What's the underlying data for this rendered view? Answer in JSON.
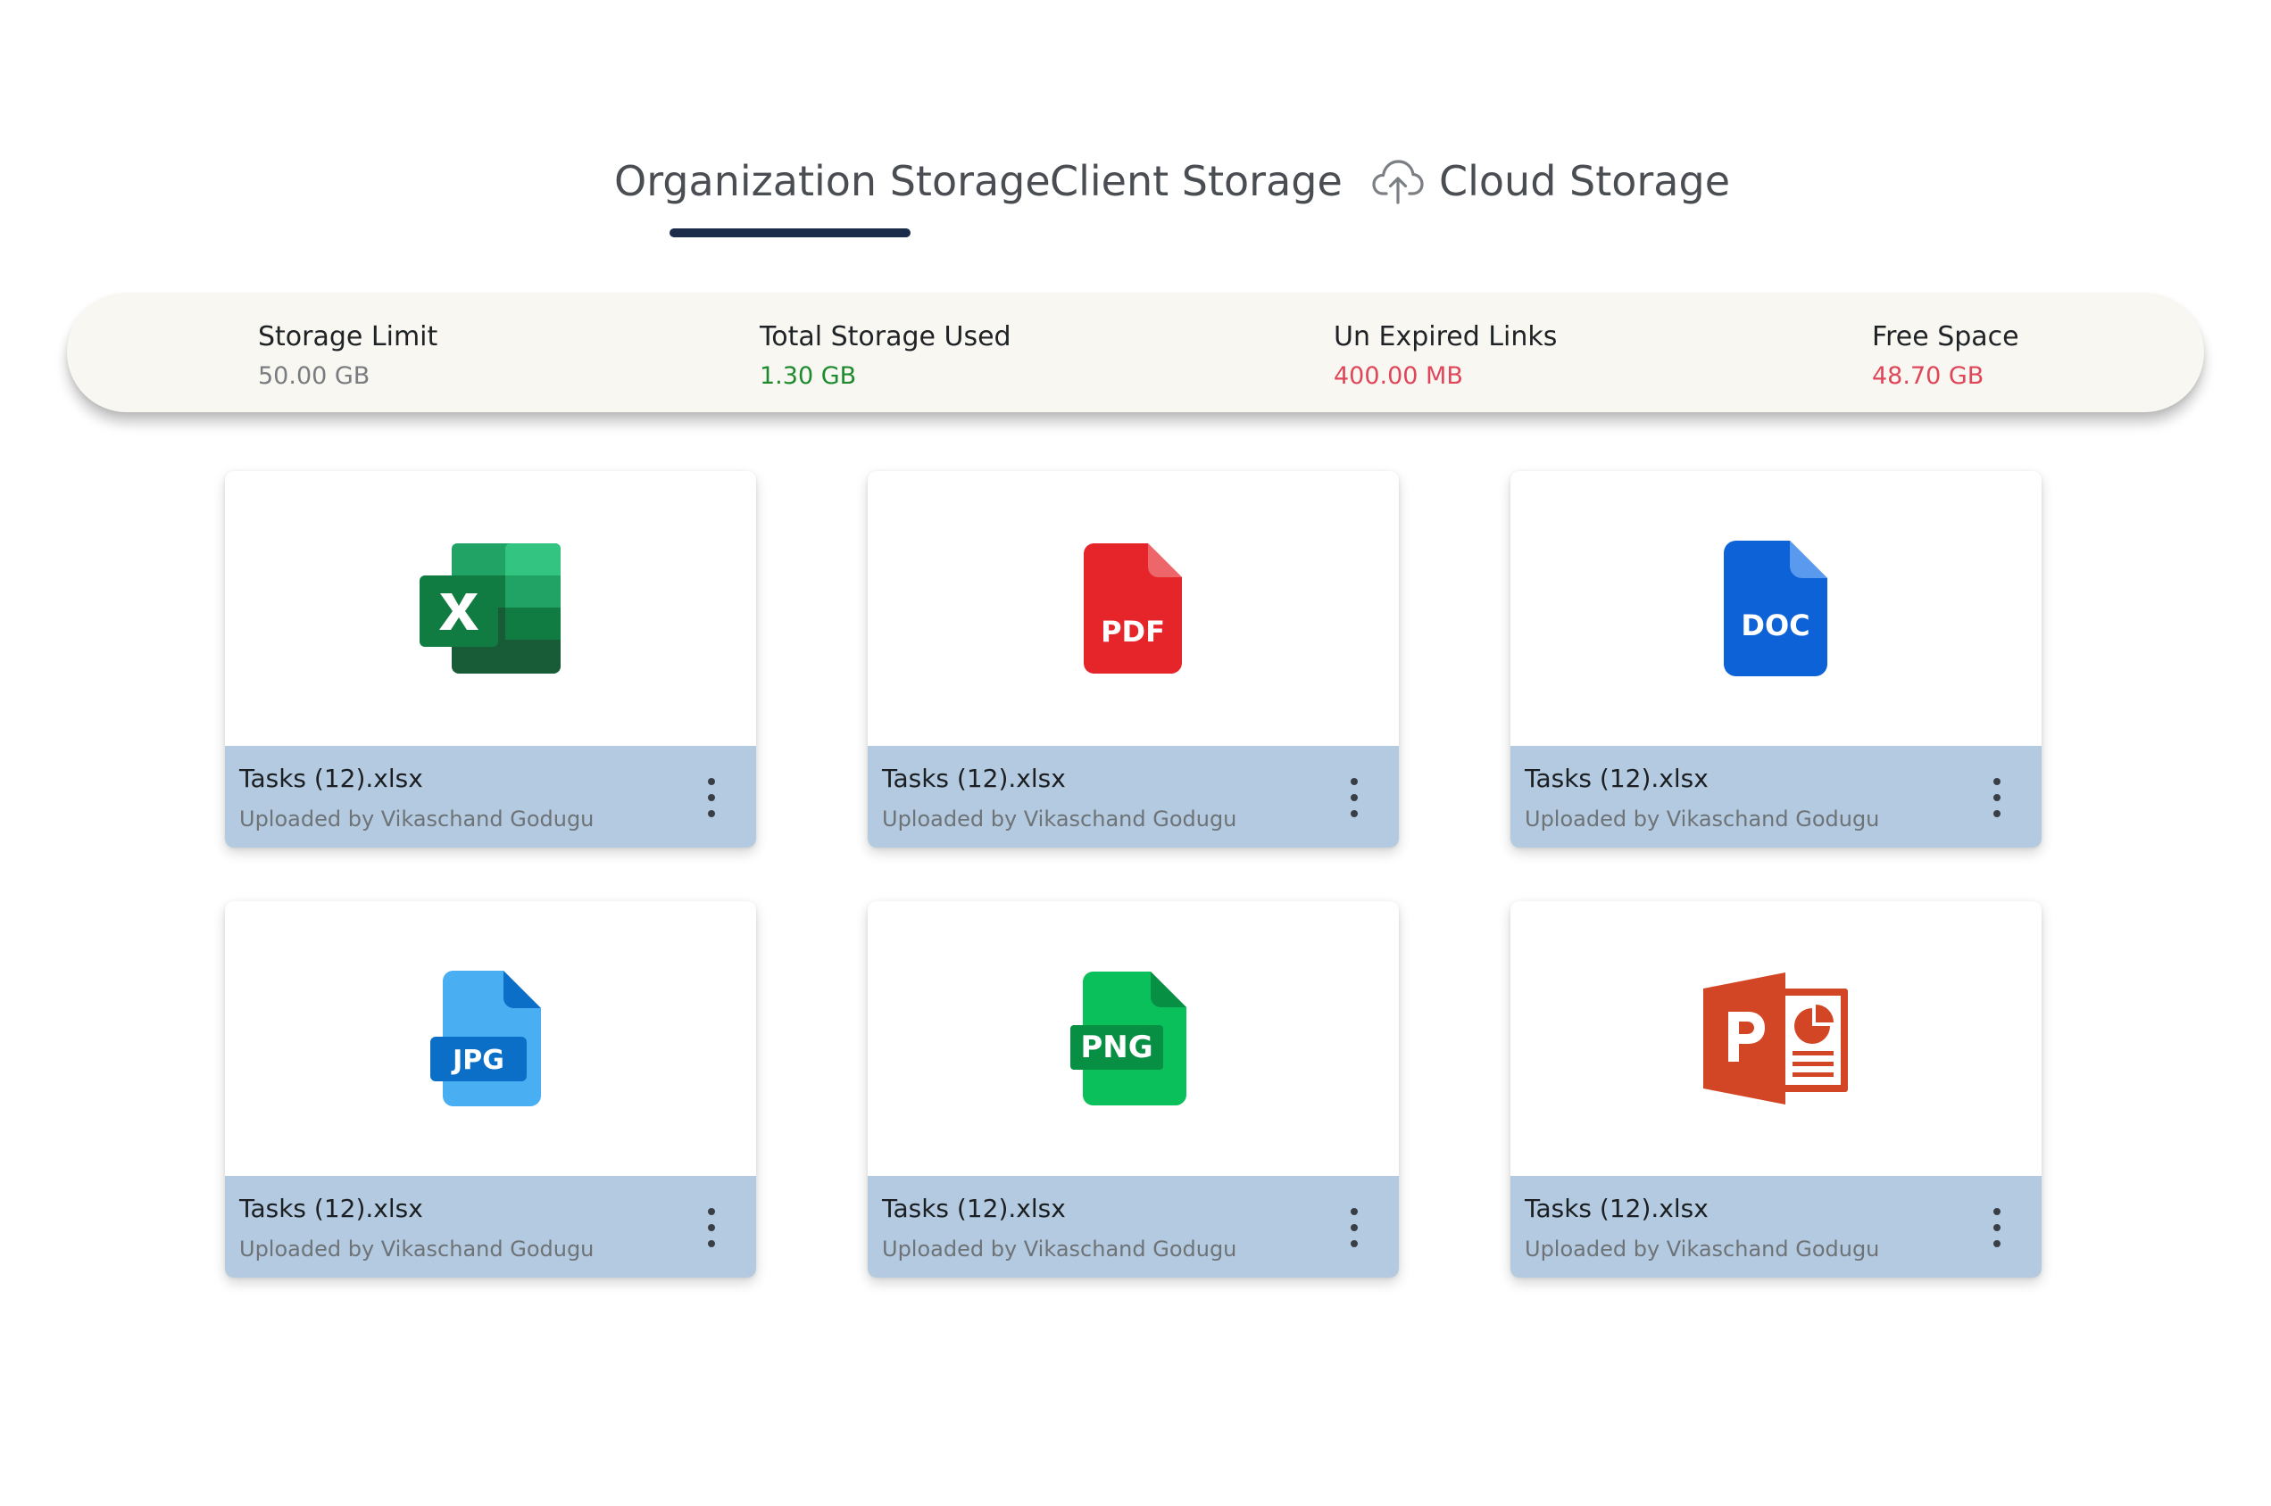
{
  "tabs": [
    {
      "label": "Organization Storage",
      "active": true
    },
    {
      "label": "Client Storage",
      "active": false
    },
    {
      "label": "Cloud Storage",
      "active": false,
      "icon": "cloud-upload-icon"
    }
  ],
  "stats": [
    {
      "label": "Storage Limit",
      "value": "50.00 GB",
      "color": "#7a7d80"
    },
    {
      "label": "Total Storage Used",
      "value": "1.30 GB",
      "color": "#1e8a2e"
    },
    {
      "label": "Un Expired Links",
      "value": "400.00 MB",
      "color": "#e0465a"
    },
    {
      "label": "Free Space",
      "value": "48.70 GB",
      "color": "#e0465a"
    }
  ],
  "files": [
    {
      "name": "Tasks (12).xlsx",
      "uploader": "Uploaded by Vikaschand Godugu",
      "icon": "excel-file-icon"
    },
    {
      "name": "Tasks (12).xlsx",
      "uploader": "Uploaded by Vikaschand Godugu",
      "icon": "pdf-file-icon",
      "badge": "PDF"
    },
    {
      "name": "Tasks (12).xlsx",
      "uploader": "Uploaded by Vikaschand Godugu",
      "icon": "doc-file-icon",
      "badge": "DOC"
    },
    {
      "name": "Tasks (12).xlsx",
      "uploader": "Uploaded by Vikaschand Godugu",
      "icon": "jpg-file-icon",
      "badge": "JPG"
    },
    {
      "name": "Tasks (12).xlsx",
      "uploader": "Uploaded by Vikaschand Godugu",
      "icon": "png-file-icon",
      "badge": "PNG"
    },
    {
      "name": "Tasks (12).xlsx",
      "uploader": "Uploaded by Vikaschand Godugu",
      "icon": "powerpoint-file-icon"
    }
  ],
  "colors": {
    "tab_underline": "#1b2c4b",
    "card_footer": "#b4cae0",
    "stats_bar": "#f8f7f2",
    "excel_green": "#1d6f42",
    "pdf_red": "#e5252a",
    "doc_blue": "#0d62d8",
    "jpg_blue": "#4aaef2",
    "png_green": "#0ac05a",
    "ppt_orange": "#d24625"
  }
}
